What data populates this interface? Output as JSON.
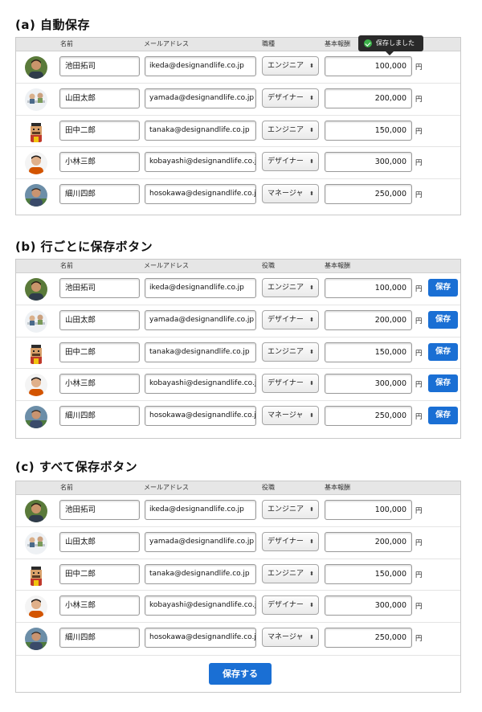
{
  "sections": {
    "a": {
      "title": "(a) 自動保存",
      "headers": {
        "name": "名前",
        "email": "メールアドレス",
        "role": "職種",
        "pay": "基本報酬"
      },
      "toast": "保存しました"
    },
    "b": {
      "title": "(b) 行ごとに保存ボタン",
      "headers": {
        "name": "名前",
        "email": "メールアドレス",
        "role": "役職",
        "pay": "基本報酬"
      },
      "row_button": "保存"
    },
    "c": {
      "title": "(c) すべて保存ボタン",
      "headers": {
        "name": "名前",
        "email": "メールアドレス",
        "role": "役職",
        "pay": "基本報酬"
      },
      "save_all_button": "保存する"
    }
  },
  "rows": [
    {
      "name": "池田拓司",
      "email": "ikeda@designandlife.co.jp",
      "role": "エンジニア",
      "pay": "100,000",
      "unit": "円",
      "avatar": "avatar-ikeda-icon"
    },
    {
      "name": "山田太郎",
      "email": "yamada@designandlife.co.jp",
      "role": "デザイナー",
      "pay": "200,000",
      "unit": "円",
      "avatar": "avatar-yamada-icon"
    },
    {
      "name": "田中二郎",
      "email": "tanaka@designandlife.co.jp",
      "role": "エンジニア",
      "pay": "150,000",
      "unit": "円",
      "avatar": "avatar-tanaka-icon"
    },
    {
      "name": "小林三郎",
      "email": "kobayashi@designandlife.co.jp",
      "role": "デザイナー",
      "pay": "300,000",
      "unit": "円",
      "avatar": "avatar-kobayashi-icon"
    },
    {
      "name": "細川四郎",
      "email": "hosokawa@designandlife.co.jp",
      "role": "マネージャ",
      "pay": "250,000",
      "unit": "円",
      "avatar": "avatar-hosokawa-icon"
    }
  ],
  "select_arrow": "⬍",
  "colors": {
    "accent": "#1a6fd4",
    "toast_bg": "#2a2a2a",
    "check": "#3cb34a",
    "header_bg": "#e6e6e6"
  }
}
